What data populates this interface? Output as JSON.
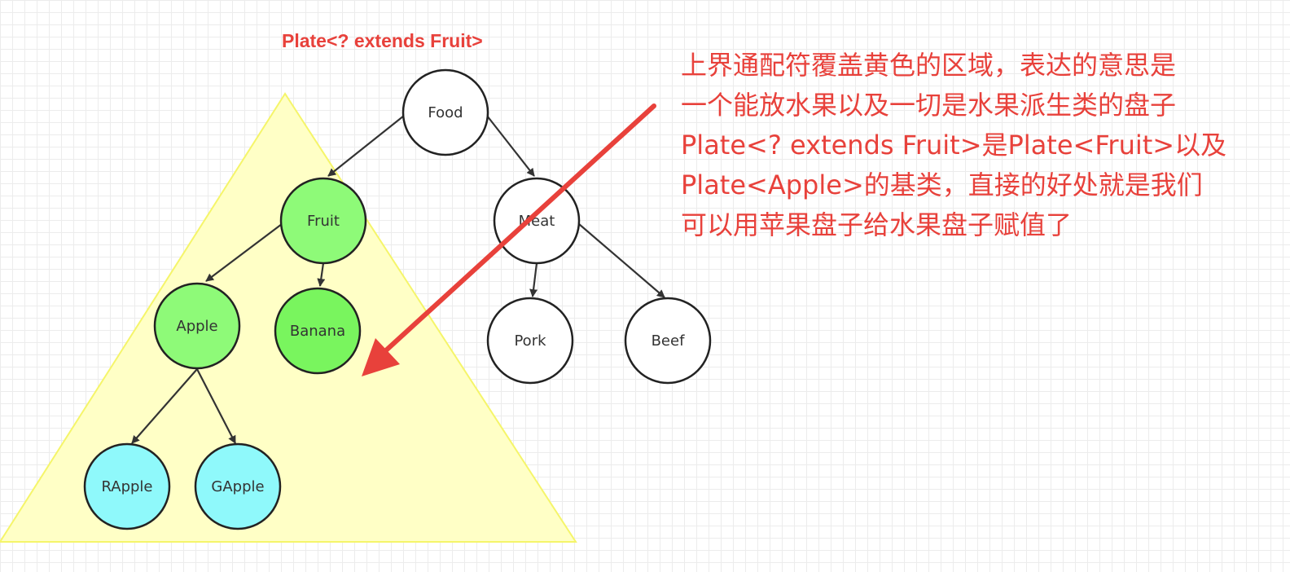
{
  "title": "Plate<? extends Fruit>",
  "nodes": {
    "food": "Food",
    "fruit": "Fruit",
    "meat": "Meat",
    "apple": "Apple",
    "banana": "Banana",
    "pork": "Pork",
    "beef": "Beef",
    "rapple": "RApple",
    "gapple": "GApple"
  },
  "annotation_lines": [
    "上界通配符覆盖黄色的区域，表达的意思是",
    "一个能放水果以及一切是水果派生类的盘子",
    "Plate<? extends Fruit>是Plate<Fruit>以及",
    "Plate<Apple>的基类，直接的好处就是我们",
    "可以用苹果盘子给水果盘子赋值了"
  ],
  "colors": {
    "accent_red": "#e8413b",
    "triangle_fill": "#ffffc6",
    "triangle_stroke": "#f5f56a",
    "node_green": "#8efa78",
    "node_green_dark": "#79f55e",
    "node_cyan": "#8ff9fb",
    "node_white": "#ffffff",
    "edge": "#333333"
  }
}
